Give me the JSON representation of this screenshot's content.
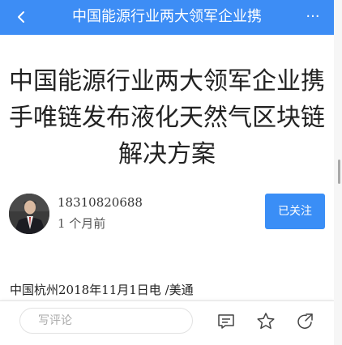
{
  "header": {
    "title": "中国能源行业两大领军企业携",
    "back_icon": "chevron-left-icon",
    "more_label": "···",
    "background_color": "#3d8df5"
  },
  "article": {
    "title": "中国能源行业两大领军企业携手唯链发布液化天然气区块链解决方案",
    "author": {
      "name": "18310820688",
      "time_ago": "1 个月前",
      "follow_label": "已关注"
    },
    "source_line": "中国杭州2018年11月1日电 /美通"
  },
  "bottom_bar": {
    "comment_placeholder": "写评论",
    "icons": [
      "comment-icon",
      "star-icon",
      "share-icon"
    ]
  },
  "colors": {
    "accent": "#3a8ef6",
    "title_text": "#222222"
  }
}
